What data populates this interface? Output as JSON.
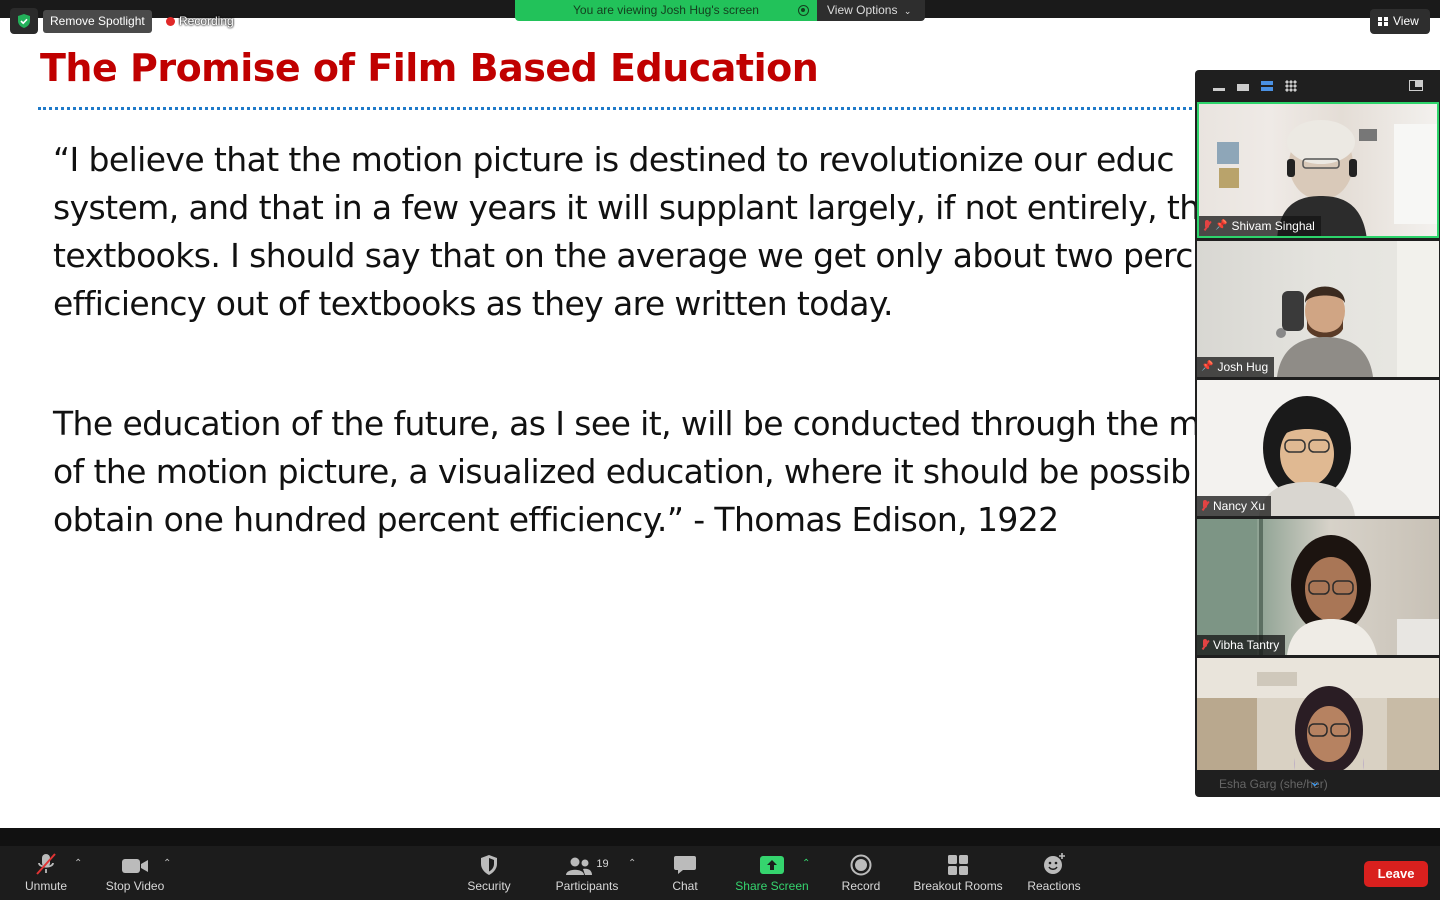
{
  "top": {
    "remove_spotlight": "Remove Spotlight",
    "recording": "Recording",
    "viewing_banner": "You are viewing Josh Hug's screen",
    "view_options": "View Options",
    "view": "View"
  },
  "slide": {
    "title": "The Promise of Film Based Education",
    "lines": [
      "“I believe that the motion picture is destined to revolutionize our educ",
      "system, and that in a few years it will supplant largely, if not entirely, th",
      "textbooks. I should say that on the average we get only about two perc",
      "efficiency out of textbooks as they are written today."
    ],
    "lines2": [
      "The education of the future, as I see it, will be conducted through the m",
      "of the motion picture, a visualized education, where it should be possib",
      "obtain one hundred percent efficiency.” - Thomas Edison, 1922"
    ]
  },
  "participants": [
    {
      "name": "Shivam Singhal"
    },
    {
      "name": "Josh Hug"
    },
    {
      "name": "Nancy Xu"
    },
    {
      "name": "Vibha Tantry"
    },
    {
      "name": "Esha Garg (she/her)"
    }
  ],
  "toolbar": {
    "unmute": "Unmute",
    "stop_video": "Stop Video",
    "security": "Security",
    "participants": "Participants",
    "participants_count": "19",
    "chat": "Chat",
    "share_screen": "Share Screen",
    "record": "Record",
    "breakout_rooms": "Breakout Rooms",
    "reactions": "Reactions",
    "leave": "Leave"
  },
  "colors": {
    "accent_green": "#22c25a",
    "title_red": "#c00000",
    "leave_red": "#d9201e"
  }
}
